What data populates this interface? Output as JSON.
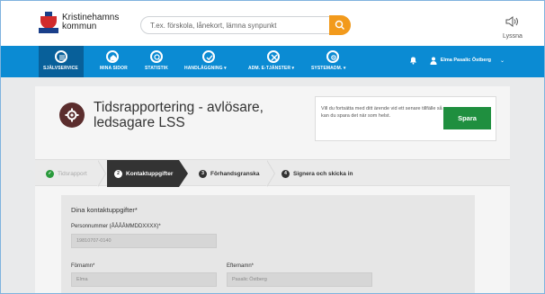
{
  "header": {
    "logo_line1": "Kristinehamns",
    "logo_line2": "kommun",
    "search_placeholder": "T.ex. förskola, lånekort, lämna synpunkt",
    "listen_label": "Lyssna"
  },
  "nav": {
    "items": [
      {
        "label": "SJÄLVSERVICE",
        "icon": "list-icon",
        "active": true
      },
      {
        "label": "MINA SIDOR",
        "icon": "home-icon",
        "active": false
      },
      {
        "label": "STATISTIK",
        "icon": "search-icon",
        "active": false
      },
      {
        "label": "HANDLÄGGNING ▾",
        "icon": "check-icon",
        "active": false
      },
      {
        "label": "ADM. E-TJÄNSTER ▾",
        "icon": "tools-icon",
        "active": false
      },
      {
        "label": "SYSTEMADM. ▾",
        "icon": "gear-icon",
        "active": false
      }
    ],
    "user_name": "Elma Pasalic Östberg",
    "user_caret": "⌄"
  },
  "page": {
    "title_line1": "Tidsrapportering - avlösare,",
    "title_line2": "ledsagare LSS",
    "save_info": "Vill du fortsätta med ditt ärende vid ett senare tillfälle så kan du spara det när som helst.",
    "save_button": "Spara"
  },
  "stepper": {
    "steps": [
      {
        "number": "✓",
        "label": "Tidsrapport",
        "state": "done"
      },
      {
        "number": "2",
        "label": "Kontaktuppgifter",
        "state": "active"
      },
      {
        "number": "3",
        "label": "Förhandsgranska",
        "state": "todo"
      },
      {
        "number": "4",
        "label": "Signera och skicka in",
        "state": "todo"
      }
    ]
  },
  "form": {
    "heading": "Dina kontaktuppgifter*",
    "personnummer_label": "Personnummer (ÅÅÅÅMMDDXXXX)*",
    "personnummer_value": "19810707-0140",
    "fornamn_label": "Förnamn*",
    "fornamn_value": "Elma",
    "efternamn_label": "Efternamn*",
    "efternamn_value": "Pasalic Östberg"
  },
  "colors": {
    "nav_blue": "#0b8bd3",
    "nav_active": "#08609a",
    "search_orange": "#f29a1c",
    "save_green": "#1f8f3f",
    "step_active": "#333333",
    "title_icon": "#5b2d2d"
  }
}
